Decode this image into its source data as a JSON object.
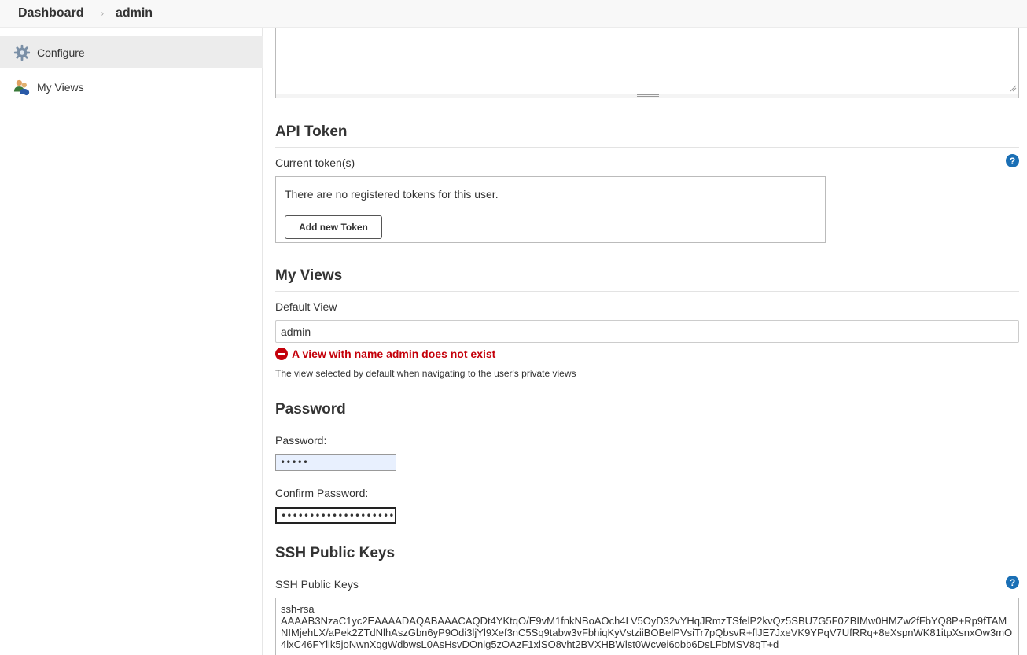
{
  "breadcrumb": {
    "home": "Dashboard",
    "separator": "›",
    "current": "admin"
  },
  "sidebar": {
    "items": [
      {
        "label": "Configure",
        "icon": "gear-icon",
        "active": true
      },
      {
        "label": "My Views",
        "icon": "users-icon",
        "active": false
      }
    ]
  },
  "api_token": {
    "title": "API Token",
    "current_label": "Current token(s)",
    "empty_message": "There are no registered tokens for this user.",
    "add_button": "Add new Token",
    "help": "?"
  },
  "my_views": {
    "title": "My Views",
    "default_view_label": "Default View",
    "default_view_value": "admin",
    "error": "A view with name admin does not exist",
    "description": "The view selected by default when navigating to the user's private views"
  },
  "password": {
    "title": "Password",
    "password_label": "Password:",
    "password_value": "•••••",
    "confirm_label": "Confirm Password:",
    "confirm_value": "••••••••••••••••••••••••••••••••"
  },
  "ssh": {
    "title": "SSH Public Keys",
    "field_label": "SSH Public Keys",
    "help": "?",
    "value": "ssh-rsa\nAAAAB3NzaC1yc2EAAAADAQABAAACAQDt4YKtqO/E9vM1fnkNBoAOch4LV5OyD32vYHqJRmzTSfelP2kvQz5SBU7G5F0ZBIMw0HMZw2fFbYQ8P+Rp9fTAMNIMjehLX/aPek2ZTdNlhAszGbn6yP9Odi3ljYl9Xef3nC5Sq9tabw3vFbhiqKyVstziiBOBelPVsiTr7pQbsvR+flJE7JxeVK9YPqV7UfRRq+8eXspnWK81itpXsnxOw3mO4lxC46FYlik5joNwnXqgWdbwsL0AsHsvDOnlg5zOAzF1xlSO8vht2BVXHBWlst0Wcvei6obb6DsLFbMSV8qT+d"
  },
  "colors": {
    "error": "#c4000a",
    "help": "#1a6fb5",
    "active_bg": "#ececec"
  }
}
